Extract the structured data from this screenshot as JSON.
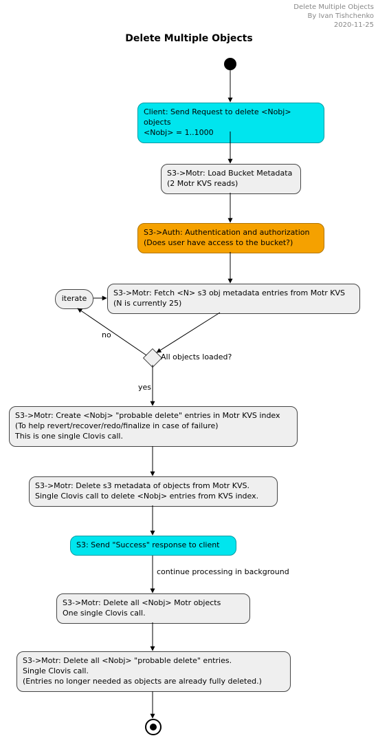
{
  "meta": {
    "line1": "Delete Multiple Objects",
    "line2": "By Ivan Tishchenko",
    "line3": "2020-11-25"
  },
  "title": "Delete Multiple Objects",
  "nodes": {
    "client": "Client: Send Request to delete <Nobj> objects\n<Nobj> = 1..1000",
    "loadBucket": "S3->Motr: Load Bucket Metadata\n(2 Motr KVS reads)",
    "auth": "S3->Auth: Authentication and authorization\n(Does user have access to the bucket?)",
    "fetch": "S3->Motr: Fetch <N> s3 obj metadata entries from Motr KVS\n(N is currently 25)",
    "iterate": "iterate",
    "decision": "All objects loaded?",
    "createProbable": "S3->Motr: Create <Nobj> \"probable delete\" entries in Motr KVS index\n(To help revert/recover/redo/finalize in case of failure)\nThis is one single Clovis call.",
    "deleteMeta": "S3->Motr: Delete s3 metadata of objects from Motr KVS.\nSingle Clovis call to delete <Nobj> entries from KVS index.",
    "success": "S3: Send \"Success\" response to client",
    "deleteObjs": "S3->Motr: Delete all <Nobj> Motr objects\nOne single Clovis call.",
    "deleteProbable": "S3->Motr: Delete all <Nobj> \"probable delete\" entries.\nSingle Clovis call.\n(Entries no longer needed as objects are already fully deleted.)"
  },
  "edgeLabels": {
    "no": "no",
    "yes": "yes",
    "continue": "continue processing in background"
  }
}
